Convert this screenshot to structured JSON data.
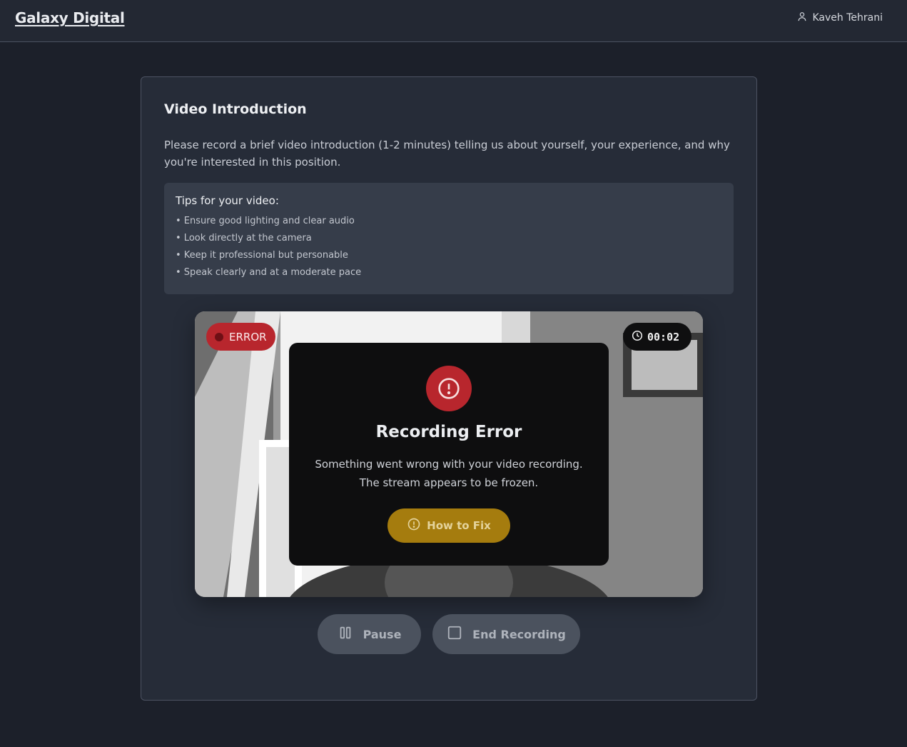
{
  "header": {
    "brand": "Galaxy Digital",
    "user_name": "Kaveh Tehrani"
  },
  "intro": {
    "title": "Video Introduction",
    "description": "Please record a brief video introduction (1-2 minutes) telling us about yourself, your experience, and why you're interested in this position."
  },
  "tips": {
    "title": "Tips for your video:",
    "items": [
      "• Ensure good lighting and clear audio",
      "• Look directly at the camera",
      "• Keep it professional but personable",
      "• Speak clearly and at a moderate pace"
    ]
  },
  "video": {
    "status_badge": "ERROR",
    "timer": "00:02",
    "error": {
      "title": "Recording Error",
      "message_line1": "Something went wrong with your video recording.",
      "message_line2": "The stream appears to be frozen.",
      "fix_button": "How to Fix"
    }
  },
  "controls": {
    "pause_label": "Pause",
    "end_label": "End Recording"
  },
  "colors": {
    "error_red": "#b8262d",
    "fix_gold": "#a57c0e",
    "background": "#1c202a",
    "card": "#262c38"
  },
  "icons": [
    "user-icon",
    "clock-icon",
    "alert-circle-icon",
    "pause-icon",
    "stop-icon"
  ]
}
